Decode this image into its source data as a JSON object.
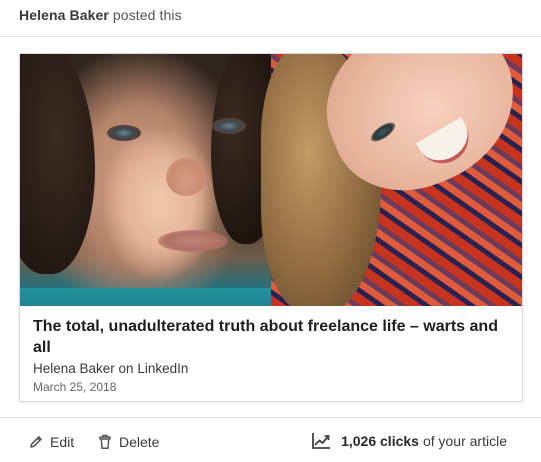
{
  "header": {
    "author_name": "Helena Baker",
    "action_text": "posted this"
  },
  "article": {
    "title": "The total, unadulterated truth about freelance life – warts and all",
    "source": "Helena Baker on LinkedIn",
    "date": "March 25, 2018"
  },
  "footer": {
    "edit_label": "Edit",
    "delete_label": "Delete",
    "clicks_count": "1,026 clicks",
    "clicks_suffix": "of your article"
  },
  "icons": {
    "edit": "pencil-icon",
    "delete": "trash-icon",
    "stats": "trending-chart-icon"
  }
}
